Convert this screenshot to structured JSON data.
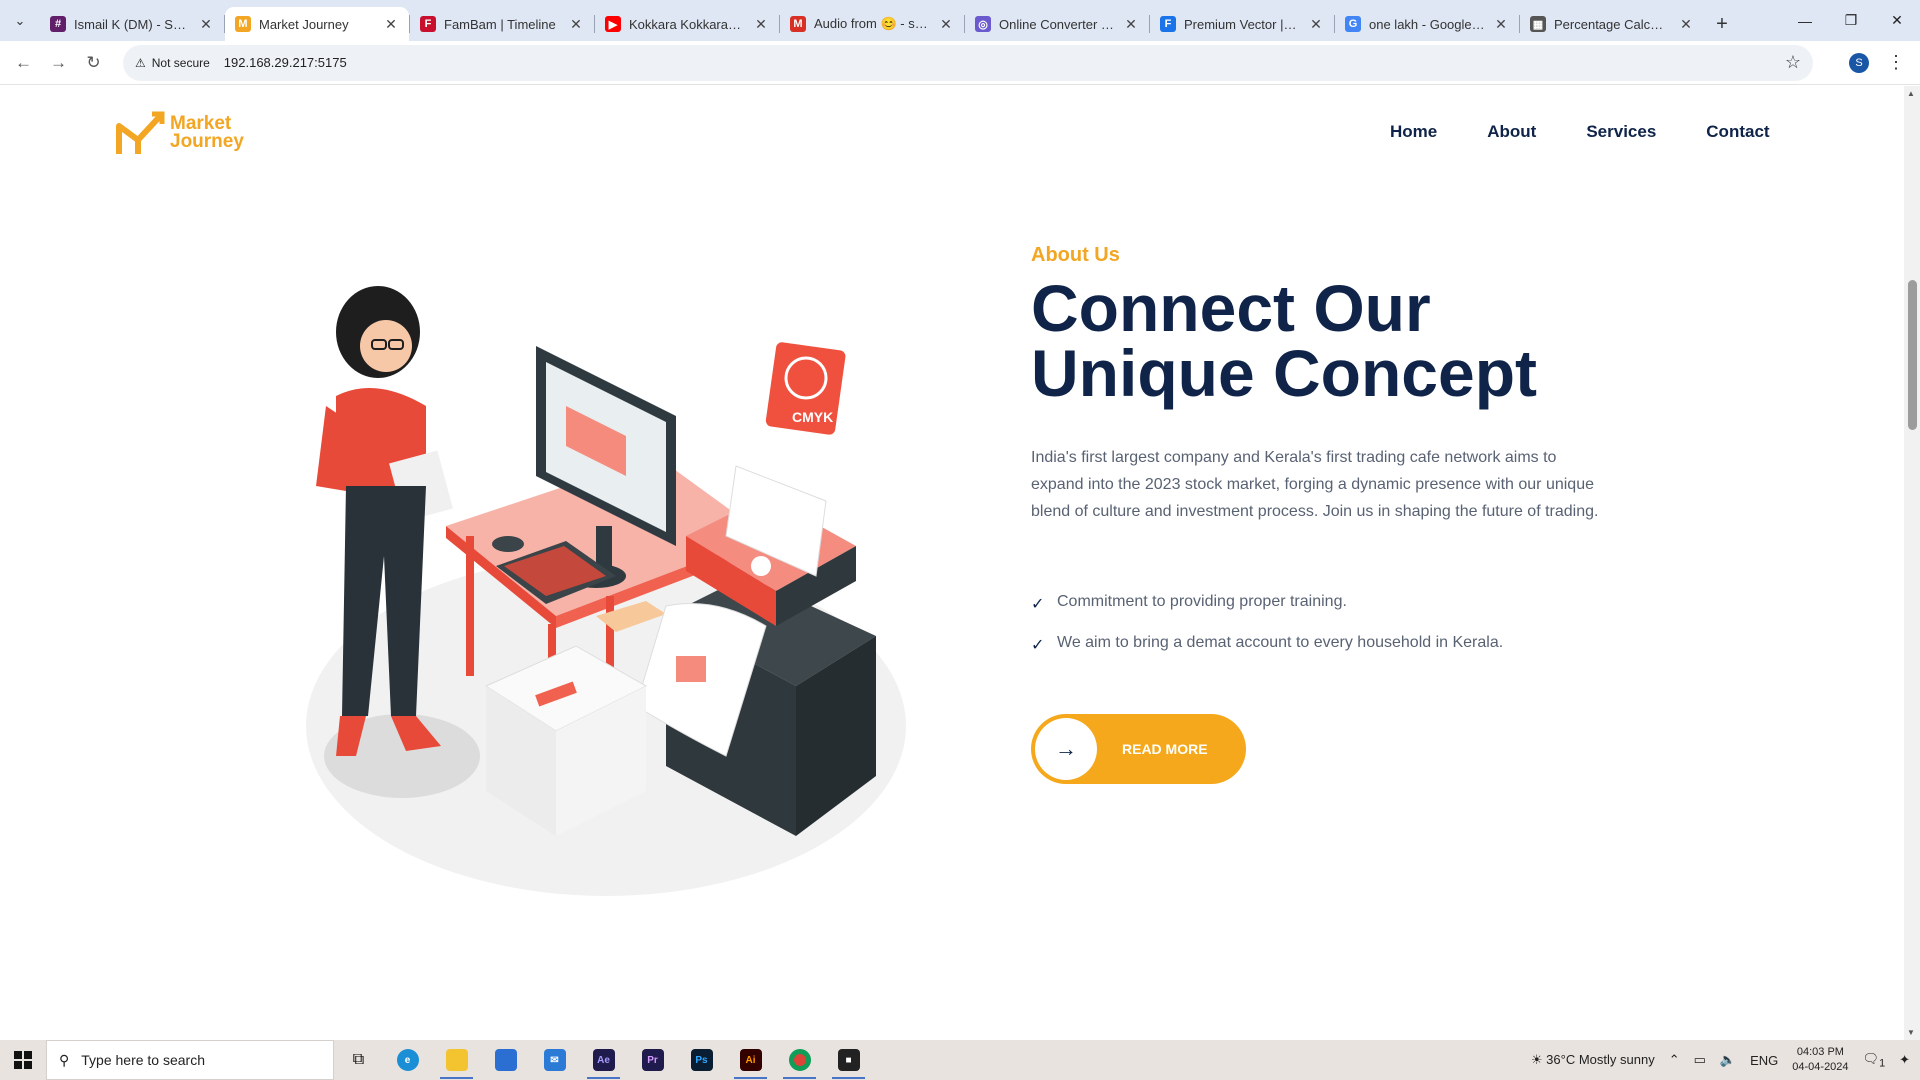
{
  "browser": {
    "tabs": [
      {
        "title": "Ismail K (DM) - Seclob",
        "fav_color": "#611f69",
        "fav_glyph": "#"
      },
      {
        "title": "Market Journey",
        "fav_color": "#f2a623",
        "fav_glyph": "M",
        "active": true
      },
      {
        "title": "FamBam | Timeline",
        "fav_color": "#c8102e",
        "fav_glyph": "F"
      },
      {
        "title": "Kokkara Kokkarako -",
        "fav_color": "#ff0000",
        "fav_glyph": "▶"
      },
      {
        "title": "Audio from 😊 - secl",
        "fav_color": "#d93025",
        "fav_glyph": "M"
      },
      {
        "title": "Online Converter - Co",
        "fav_color": "#6a5acd",
        "fav_glyph": "◎"
      },
      {
        "title": "Premium Vector | Cou",
        "fav_color": "#1a73e8",
        "fav_glyph": "F"
      },
      {
        "title": "one lakh - Google Se",
        "fav_color": "#4285f4",
        "fav_glyph": "G"
      },
      {
        "title": "Percentage Calculato",
        "fav_color": "#555555",
        "fav_glyph": "▦"
      }
    ],
    "not_secure_label": "Not secure",
    "url": "192.168.29.217:5175",
    "profile_initial": "S"
  },
  "site": {
    "logo_line1": "Market",
    "logo_line2": "Journey",
    "nav": [
      "Home",
      "About",
      "Services",
      "Contact"
    ],
    "about_label": "About Us",
    "headline_line1": "Connect Our",
    "headline_line2": "Unique Concept",
    "description": "India's first largest company and Kerala's first trading cafe network aims to expand into the 2023 stock market, forging a dynamic presence with our unique blend of culture and investment process. Join us in shaping the future of trading.",
    "checks": [
      "Commitment to providing proper training.",
      "We aim to bring a demat account to every household in Kerala."
    ],
    "read_more": "READ MORE",
    "accent_color": "#f5a81b",
    "navy_color": "#0f2448"
  },
  "taskbar": {
    "search_placeholder": "Type here to search",
    "weather": "36°C  Mostly sunny",
    "lang": "ENG",
    "time": "04:03 PM",
    "date": "04-04-2024",
    "notif_count": "1"
  }
}
